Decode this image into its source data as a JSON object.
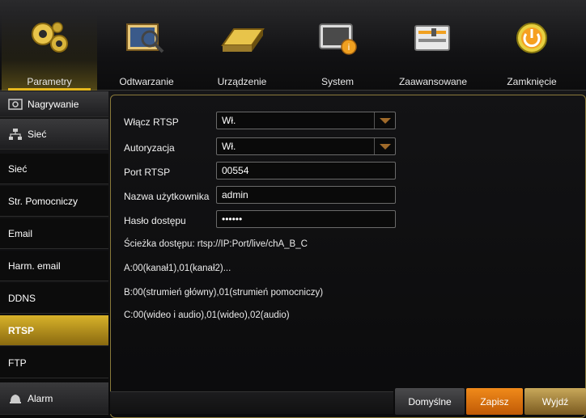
{
  "toolbar": {
    "tabs": [
      {
        "label": "Parametry",
        "icon": "gears-icon"
      },
      {
        "label": "Odtwarzanie",
        "icon": "playback-search-icon"
      },
      {
        "label": "Urządzenie",
        "icon": "hard-drive-icon"
      },
      {
        "label": "System",
        "icon": "system-info-icon"
      },
      {
        "label": "Zaawansowane",
        "icon": "advanced-settings-icon"
      },
      {
        "label": "Zamknięcie",
        "icon": "power-icon"
      }
    ],
    "active_tab": "Parametry"
  },
  "sidebar": {
    "items": [
      {
        "label": "Nagrywanie",
        "type": "group"
      },
      {
        "label": "Sieć",
        "type": "group"
      },
      {
        "label": "Sieć",
        "type": "item"
      },
      {
        "label": "Str. Pomocniczy",
        "type": "item"
      },
      {
        "label": "Email",
        "type": "item"
      },
      {
        "label": "Harm. email",
        "type": "item"
      },
      {
        "label": "DDNS",
        "type": "item"
      },
      {
        "label": "RTSP",
        "type": "item"
      },
      {
        "label": "FTP",
        "type": "item"
      },
      {
        "label": "Alarm",
        "type": "group"
      }
    ],
    "active_item": "RTSP"
  },
  "form": {
    "enable_rtsp": {
      "label": "Włącz RTSP",
      "value": "Wł."
    },
    "authorization": {
      "label": "Autoryzacja",
      "value": "Wł."
    },
    "port": {
      "label": "Port RTSP",
      "value": "00554"
    },
    "username": {
      "label": "Nazwa użytkownika",
      "value": "admin"
    },
    "password": {
      "label": "Hasło dostępu",
      "value": "••••••"
    }
  },
  "info": {
    "path": "Ścieżka dostępu: rtsp://IP:Port/live/chA_B_C",
    "a": "A:00(kanał1),01(kanał2)...",
    "b": "B:00(strumień główny),01(strumień pomocniczy)",
    "c": "C:00(wideo i audio),01(wideo),02(audio)"
  },
  "buttons": {
    "default": "Domyślne",
    "save": "Zapisz",
    "exit": "Wyjdź"
  },
  "colors": {
    "accent_gold": "#e6b81e",
    "save_orange": "#e8781a",
    "dropdown_arrow": "#a06a2a"
  }
}
